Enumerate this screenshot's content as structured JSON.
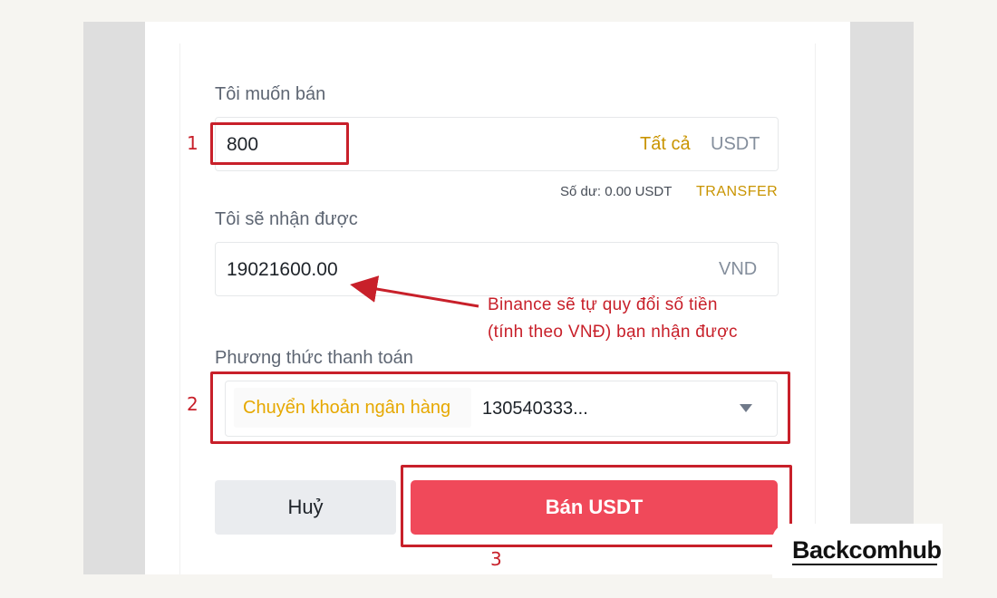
{
  "sell_form": {
    "sell_label": "Tôi muốn bán",
    "sell_amount": "800",
    "all_link": "Tất cả",
    "sell_unit": "USDT",
    "balance_text": "Số dư: 0.00 USDT",
    "transfer_link": "TRANSFER",
    "receive_label": "Tôi sẽ nhận được",
    "receive_amount": "19021600.00",
    "receive_unit": "VND",
    "payment_label": "Phương thức thanh toán",
    "payment_method": "Chuyển khoản ngân hàng",
    "payment_account": "130540333...",
    "cancel_button": "Huỷ",
    "sell_button": "Bán USDT"
  },
  "annotations": {
    "step1": "1",
    "step2": "2",
    "step3": "3",
    "note_line1": "Binance sẽ tự quy đổi số tiền",
    "note_line2": "(tính theo VNĐ) bạn nhận được",
    "color": "#c8202a"
  },
  "watermark": {
    "logo_text": "Backcomhub"
  },
  "colors": {
    "accent_gold": "#c99400",
    "sell_button": "#f0495a",
    "cancel_button": "#eaecef"
  }
}
